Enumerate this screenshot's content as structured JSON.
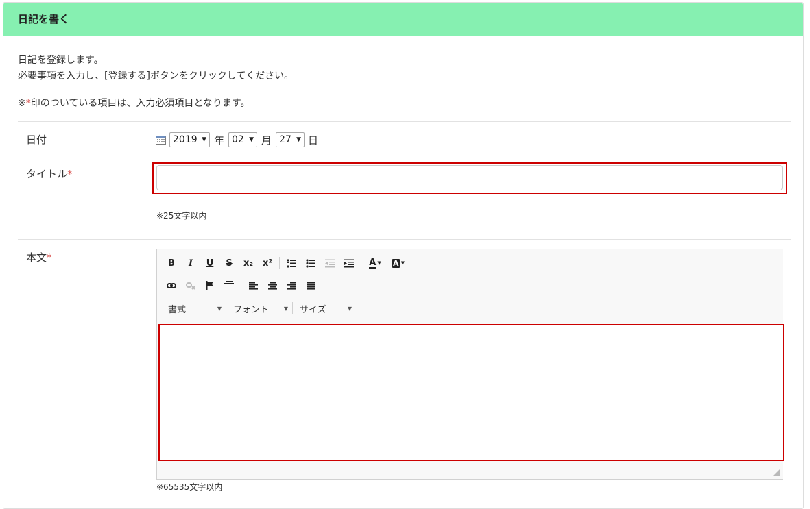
{
  "panel": {
    "title": "日記を書く"
  },
  "intro": {
    "line1": "日記を登録します。",
    "line2": "必要事項を入力し、[登録する]ボタンをクリックしてください。"
  },
  "note": {
    "prefix": "※",
    "required_mark": "*",
    "text": "印のついている項目は、入力必須項目となります。"
  },
  "date": {
    "label": "日付",
    "year": "2019",
    "year_unit": "年",
    "month": "02",
    "month_unit": "月",
    "day": "27",
    "day_unit": "日"
  },
  "title_field": {
    "label": "タイトル",
    "required_mark": "*",
    "value": "",
    "hint": "※25文字以内"
  },
  "body_field": {
    "label": "本文",
    "required_mark": "*",
    "hint": "※65535文字以内"
  },
  "toolbar": {
    "bold": "B",
    "italic": "I",
    "underline": "U",
    "strike": "S",
    "subscript": "x₂",
    "superscript": "x²",
    "format_combo": "書式",
    "font_combo": "フォント",
    "size_combo": "サイズ",
    "text_color": "A",
    "bg_color": "A",
    "icons": [
      "numbered-list-icon",
      "bulleted-list-icon",
      "outdent-icon",
      "indent-icon",
      "link-icon",
      "unlink-icon",
      "anchor-icon",
      "horizontal-rule-icon",
      "align-left-icon",
      "align-center-icon",
      "align-right-icon",
      "justify-icon"
    ]
  },
  "colors": {
    "header_bg": "#86f0b1",
    "highlight": "#cc0000",
    "required": "#d9534f"
  }
}
